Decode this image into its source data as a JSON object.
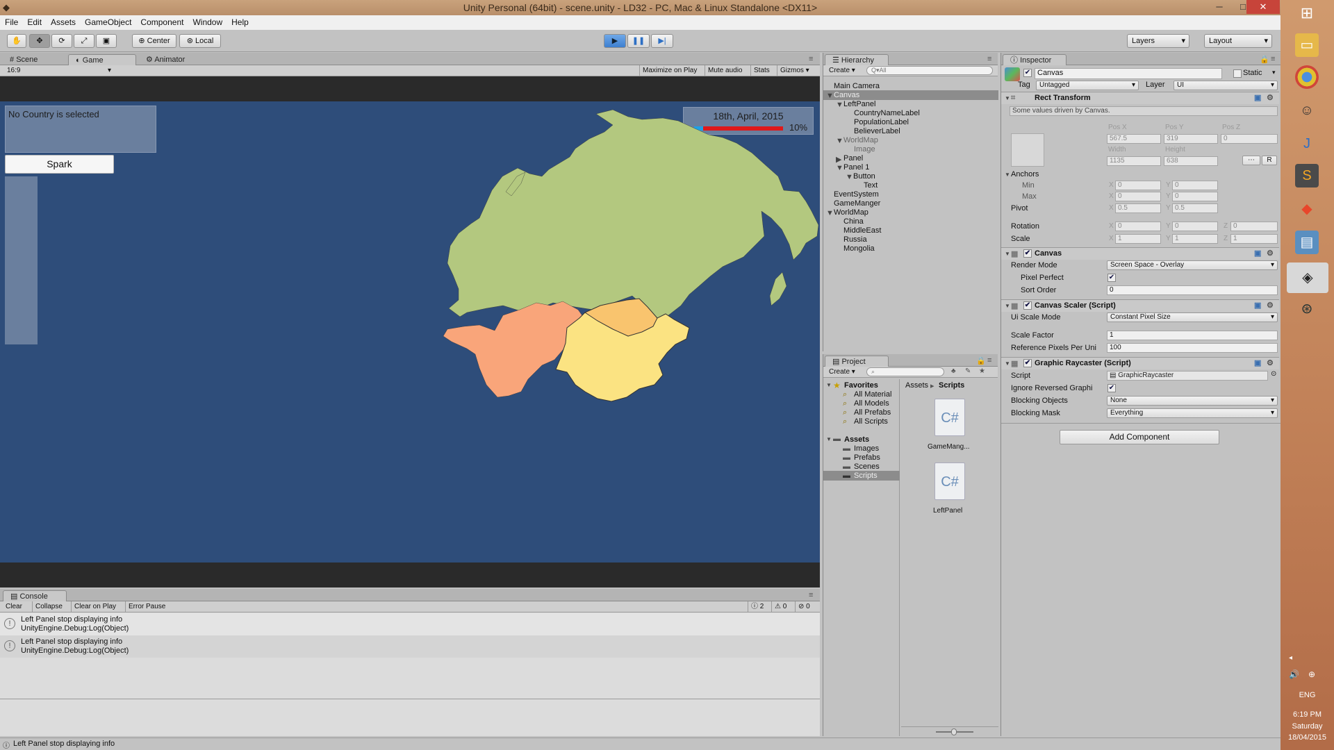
{
  "window": {
    "title": "Unity Personal (64bit) - scene.unity - LD32 - PC, Mac & Linux Standalone <DX11>",
    "minimize": "─",
    "maximize": "□",
    "close": "✕"
  },
  "menu": [
    "File",
    "Edit",
    "Assets",
    "GameObject",
    "Component",
    "Window",
    "Help"
  ],
  "toolbar": {
    "center": "Center",
    "local": "Local",
    "layers": "Layers",
    "layout": "Layout"
  },
  "tabs": {
    "scene": "Scene",
    "game": "Game",
    "animator": "Animator",
    "hierarchy": "Hierarchy",
    "inspector": "Inspector",
    "project": "Project",
    "console": "Console"
  },
  "game": {
    "aspect": "16:9",
    "maximize": "Maximize on Play",
    "mute": "Mute audio",
    "stats": "Stats",
    "gizmos": "Gizmos",
    "no_country": "No Country is selected",
    "spark": "Spark",
    "date": "18th, April, 2015",
    "progress_label": "10%",
    "progress": 0.1
  },
  "hierarchy": {
    "create": "Create",
    "search": "Q▾All",
    "items": [
      "Main Camera",
      "Canvas",
      "LeftPanel",
      "CountryNameLabel",
      "PopulationLabel",
      "BelieverLabel",
      "WorldMap",
      "Image",
      "Panel",
      "Panel 1",
      "Button",
      "Text",
      "EventSystem",
      "GameManger",
      "WorldMap",
      "China",
      "MiddleEast",
      "Russia",
      "Mongolia"
    ]
  },
  "project": {
    "create": "Create",
    "favorites": "Favorites",
    "fav_items": [
      "All Material",
      "All Models",
      "All Prefabs",
      "All Scripts"
    ],
    "assets": "Assets",
    "folders": [
      "Images",
      "Prefabs",
      "Scenes",
      "Scripts"
    ],
    "crumb_root": "Assets",
    "crumb_sep": "▸",
    "crumb_leaf": "Scripts",
    "files": [
      "GameMang...",
      "LeftPanel"
    ],
    "file_glyph": "C#"
  },
  "inspector": {
    "name": "Canvas",
    "static": "Static",
    "tag_label": "Tag",
    "tag": "Untagged",
    "layer_label": "Layer",
    "layer": "UI",
    "rect_transform": "Rect Transform",
    "driven": "Some values driven by Canvas.",
    "posx_l": "Pos X",
    "posy_l": "Pos Y",
    "posz_l": "Pos Z",
    "posx": "567.5",
    "posy": "319",
    "posz": "0",
    "width_l": "Width",
    "height_l": "Height",
    "width": "1135",
    "height": "638",
    "r_btn": "R",
    "anchors": "Anchors",
    "min": "Min",
    "max": "Max",
    "pivot": "Pivot",
    "rotation": "Rotation",
    "scale": "Scale",
    "x": "X",
    "y": "Y",
    "z": "Z",
    "zero": "0",
    "half": "0.5",
    "one": "1",
    "canvas": "Canvas",
    "render_mode_l": "Render Mode",
    "render_mode": "Screen Space - Overlay",
    "pixel_perfect": "Pixel Perfect",
    "sort_order_l": "Sort Order",
    "sort_order": "0",
    "scaler": "Canvas Scaler (Script)",
    "ui_scale_l": "Ui Scale Mode",
    "ui_scale": "Constant Pixel Size",
    "scale_factor_l": "Scale Factor",
    "scale_factor": "1",
    "ref_ppu_l": "Reference Pixels Per Uni",
    "ref_ppu": "100",
    "raycaster": "Graphic Raycaster (Script)",
    "script_l": "Script",
    "script": "GraphicRaycaster",
    "ignore_l": "Ignore Reversed Graphi",
    "blocking_obj_l": "Blocking Objects",
    "blocking_obj": "None",
    "blocking_mask_l": "Blocking Mask",
    "blocking_mask": "Everything",
    "add_component": "Add Component"
  },
  "console": {
    "clear": "Clear",
    "collapse": "Collapse",
    "clear_on_play": "Clear on Play",
    "error_pause": "Error Pause",
    "count_log": "2",
    "count_warn": "0",
    "count_err": "0",
    "entries": [
      {
        "line1": "Left Panel stop displaying info",
        "line2": "UnityEngine.Debug:Log(Object)"
      },
      {
        "line1": "Left Panel stop displaying info",
        "line2": "UnityEngine.Debug:Log(Object)"
      }
    ]
  },
  "status": "Left Panel stop displaying info",
  "taskbar": {
    "lang": "ENG",
    "time": "6:19 PM",
    "day": "Saturday",
    "date": "18/04/2015"
  },
  "colors": {
    "map_bg": "#2e4d7a",
    "russia": "#b3c87f",
    "middle_east": "#f9a57a",
    "china": "#fbe382",
    "mongolia": "#f9c46e"
  }
}
